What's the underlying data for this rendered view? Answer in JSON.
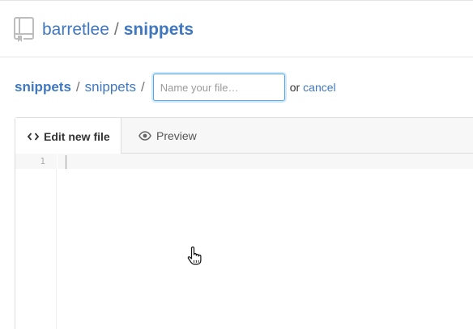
{
  "repo": {
    "owner": "barretlee",
    "separator": "/",
    "name": "snippets"
  },
  "breadcrumb": {
    "root": "snippets",
    "separator": "/",
    "folder": "snippets",
    "trailing_separator": "/"
  },
  "filename_input": {
    "placeholder": "Name your file…",
    "value": ""
  },
  "actions": {
    "or_text": "or",
    "cancel_label": "cancel"
  },
  "editor": {
    "tabs": [
      {
        "label": "Edit new file",
        "icon": "code-icon",
        "active": true
      },
      {
        "label": "Preview",
        "icon": "eye-icon",
        "active": false
      }
    ],
    "line_numbers": [
      "1"
    ]
  },
  "colors": {
    "link": "#4078c0",
    "focus_border": "#51a7e8",
    "tab_bar_bg": "#f7f7f7"
  }
}
